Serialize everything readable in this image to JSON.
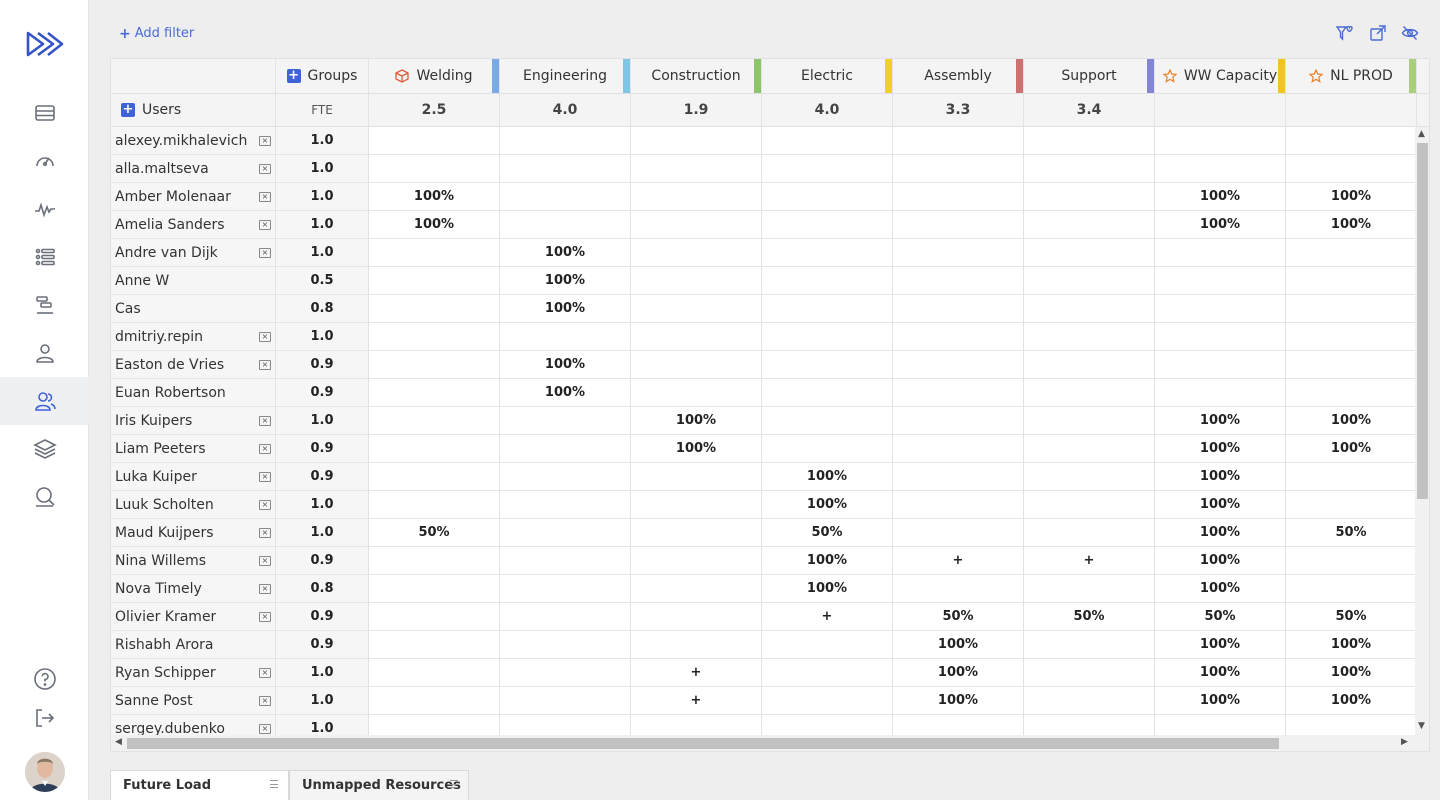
{
  "filter": {
    "add_filter_label": "Add filter"
  },
  "header": {
    "groups_label": "Groups",
    "users_label": "Users",
    "fte_label": "FTE",
    "groups": [
      {
        "name": "Welding",
        "icon": "cube-icon",
        "color": "#7aa9e8",
        "total": "2.5"
      },
      {
        "name": "Engineering",
        "icon": "",
        "color": "#7fc6e4",
        "total": "4.0"
      },
      {
        "name": "Construction",
        "icon": "",
        "color": "#8cc56a",
        "total": "1.9"
      },
      {
        "name": "Electric",
        "icon": "",
        "color": "#f2cf2a",
        "total": "4.0"
      },
      {
        "name": "Assembly",
        "icon": "",
        "color": "#cc7070",
        "total": "3.3"
      },
      {
        "name": "Support",
        "icon": "",
        "color": "#8585d6",
        "total": "3.4"
      },
      {
        "name": "WW Capacity",
        "icon": "star-icon",
        "color": "#f2c22a",
        "total": ""
      },
      {
        "name": "NL PROD",
        "icon": "star-icon",
        "color": "#a8cf7a",
        "total": ""
      }
    ]
  },
  "rows": [
    {
      "name": "alexey.mikhalevich",
      "removable": true,
      "fte": "1.0",
      "cells": [
        "",
        "",
        "",
        "",
        "",
        "",
        "",
        ""
      ]
    },
    {
      "name": "alla.maltseva",
      "removable": true,
      "fte": "1.0",
      "cells": [
        "",
        "",
        "",
        "",
        "",
        "",
        "",
        ""
      ]
    },
    {
      "name": "Amber Molenaar",
      "removable": true,
      "fte": "1.0",
      "cells": [
        "100%",
        "",
        "",
        "",
        "",
        "",
        "100%",
        "100%"
      ]
    },
    {
      "name": "Amelia Sanders",
      "removable": true,
      "fte": "1.0",
      "cells": [
        "100%",
        "",
        "",
        "",
        "",
        "",
        "100%",
        "100%"
      ]
    },
    {
      "name": "Andre van Dijk",
      "removable": true,
      "fte": "1.0",
      "cells": [
        "",
        "100%",
        "",
        "",
        "",
        "",
        "",
        ""
      ]
    },
    {
      "name": "Anne W",
      "removable": false,
      "fte": "0.5",
      "cells": [
        "",
        "100%",
        "",
        "",
        "",
        "",
        "",
        ""
      ]
    },
    {
      "name": "Cas",
      "removable": false,
      "fte": "0.8",
      "cells": [
        "",
        "100%",
        "",
        "",
        "",
        "",
        "",
        ""
      ]
    },
    {
      "name": "dmitriy.repin",
      "removable": true,
      "fte": "1.0",
      "cells": [
        "",
        "",
        "",
        "",
        "",
        "",
        "",
        ""
      ]
    },
    {
      "name": "Easton de Vries",
      "removable": true,
      "fte": "0.9",
      "cells": [
        "",
        "100%",
        "",
        "",
        "",
        "",
        "",
        ""
      ]
    },
    {
      "name": "Euan Robertson",
      "removable": false,
      "fte": "0.9",
      "cells": [
        "",
        "100%",
        "",
        "",
        "",
        "",
        "",
        ""
      ]
    },
    {
      "name": "Iris Kuipers",
      "removable": true,
      "fte": "1.0",
      "cells": [
        "",
        "",
        "100%",
        "",
        "",
        "",
        "100%",
        "100%"
      ]
    },
    {
      "name": "Liam Peeters",
      "removable": true,
      "fte": "0.9",
      "cells": [
        "",
        "",
        "100%",
        "",
        "",
        "",
        "100%",
        "100%"
      ]
    },
    {
      "name": "Luka Kuiper",
      "removable": true,
      "fte": "0.9",
      "cells": [
        "",
        "",
        "",
        "100%",
        "",
        "",
        "100%",
        ""
      ]
    },
    {
      "name": "Luuk Scholten",
      "removable": true,
      "fte": "1.0",
      "cells": [
        "",
        "",
        "",
        "100%",
        "",
        "",
        "100%",
        ""
      ]
    },
    {
      "name": "Maud Kuijpers",
      "removable": true,
      "fte": "1.0",
      "cells": [
        "50%",
        "",
        "",
        "50%",
        "",
        "",
        "100%",
        "50%"
      ]
    },
    {
      "name": "Nina Willems",
      "removable": true,
      "fte": "0.9",
      "cells": [
        "",
        "",
        "",
        "100%",
        "+",
        "+",
        "100%",
        ""
      ]
    },
    {
      "name": "Nova Timely",
      "removable": true,
      "fte": "0.8",
      "cells": [
        "",
        "",
        "",
        "100%",
        "",
        "",
        "100%",
        ""
      ]
    },
    {
      "name": "Olivier Kramer",
      "removable": true,
      "fte": "0.9",
      "cells": [
        "",
        "",
        "",
        "+",
        "50%",
        "50%",
        "50%",
        "50%"
      ]
    },
    {
      "name": "Rishabh Arora",
      "removable": false,
      "fte": "0.9",
      "cells": [
        "",
        "",
        "",
        "",
        "100%",
        "",
        "100%",
        "100%"
      ]
    },
    {
      "name": "Ryan Schipper",
      "removable": true,
      "fte": "1.0",
      "cells": [
        "",
        "",
        "+",
        "",
        "100%",
        "",
        "100%",
        "100%"
      ]
    },
    {
      "name": "Sanne Post",
      "removable": true,
      "fte": "1.0",
      "cells": [
        "",
        "",
        "+",
        "",
        "100%",
        "",
        "100%",
        "100%"
      ]
    },
    {
      "name": "sergey.dubenko",
      "removable": true,
      "fte": "1.0",
      "cells": [
        "",
        "",
        "",
        "",
        "",
        "",
        "",
        ""
      ]
    }
  ],
  "tabs": [
    {
      "label": "Future Load",
      "active": true
    },
    {
      "label": "Unmapped Resources",
      "active": false
    }
  ],
  "colors": {
    "accent": "#4062d9",
    "link": "#4a6bd6",
    "star": "#e8832a",
    "cube": "#e05a3a"
  }
}
